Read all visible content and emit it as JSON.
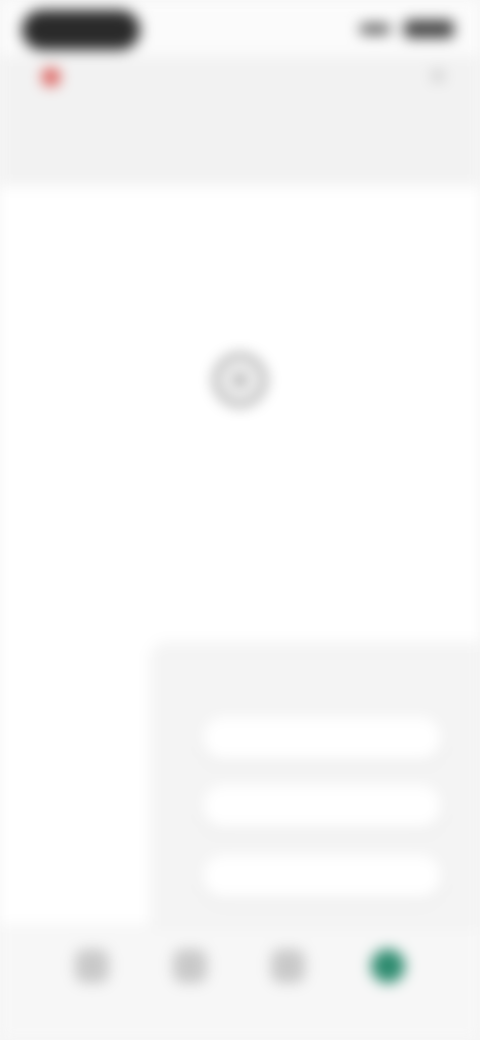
{
  "status_bar": {
    "time": "",
    "icons": [
      "signal-icon",
      "battery-icon"
    ]
  },
  "header": {
    "title": "",
    "tabs": [
      {
        "label": ""
      },
      {
        "label": ""
      },
      {
        "label": ""
      }
    ]
  },
  "empty_state": {
    "icon": "info-icon",
    "title": "",
    "description": ""
  },
  "action_sheet": {
    "buttons": [
      {
        "label": ""
      },
      {
        "label": ""
      },
      {
        "label": ""
      }
    ]
  },
  "bottom_nav": {
    "items": [
      {
        "icon": "home-icon",
        "label": ""
      },
      {
        "icon": "search-icon",
        "label": ""
      },
      {
        "icon": "profile-icon",
        "label": ""
      },
      {
        "icon": "active-tab-icon",
        "label": ""
      }
    ]
  },
  "colors": {
    "accent": "#2e8b6f",
    "back_dot": "#d9534f",
    "status_pill": "#2a2a2a"
  }
}
